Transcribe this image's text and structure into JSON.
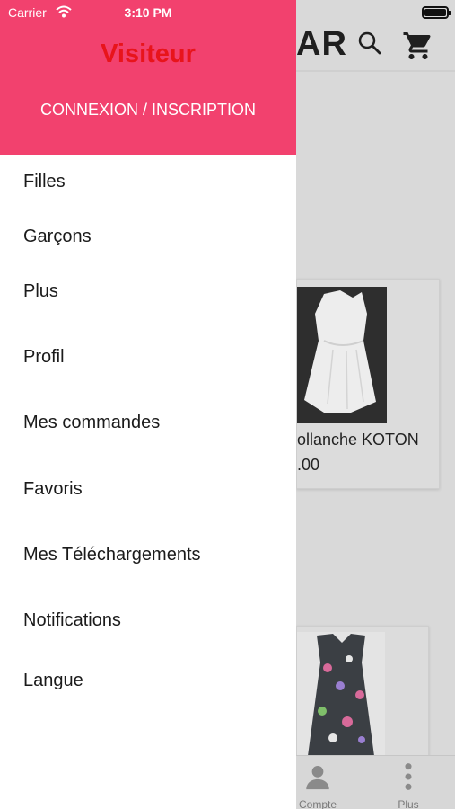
{
  "status_bar": {
    "carrier": "Carrier",
    "time": "3:10 PM",
    "battery_level": 1.0
  },
  "background": {
    "logo_fragment": "AR",
    "products": [
      {
        "name": "ollanche  KOTON",
        "price": ".00"
      }
    ],
    "tabbar": [
      {
        "label": "Compte",
        "icon": "person-icon"
      },
      {
        "label": "Plus",
        "icon": "more-vertical-icon"
      }
    ]
  },
  "drawer": {
    "title": "Visiteur",
    "login_label": "CONNEXION / INSCRIPTION",
    "items": [
      {
        "label": "Filles"
      },
      {
        "label": "Garçons"
      },
      {
        "label": "Plus"
      },
      {
        "label": "Profil"
      },
      {
        "label": "Mes commandes"
      },
      {
        "label": "Favoris"
      },
      {
        "label": "Mes Téléchargements"
      },
      {
        "label": "Notifications"
      },
      {
        "label": "Langue"
      }
    ]
  },
  "colors": {
    "drawer_header": "#f2416e",
    "visitor_title": "#e8141b",
    "overlay_bg": "#d9d9d9"
  }
}
